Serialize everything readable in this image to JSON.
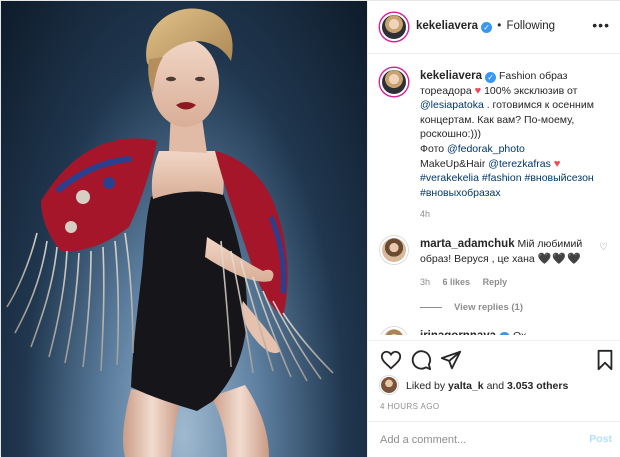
{
  "header": {
    "username": "kekeliavera",
    "dot": "•",
    "follow_label": "Following",
    "more": "•••"
  },
  "caption": {
    "username": "kekeliavera",
    "t1": "Fashion образ тореадора",
    "t2": "100% эксклюзив от",
    "mention1": "@lesiapatoka",
    "t3": ". готовимся к осенним концертам. Как вам? По-моему, роскошно:)))",
    "t4": "Фото",
    "mention2": "@fedorak_photo",
    "t5": "MakeUp&Hair",
    "mention3": "@terezkafras",
    "tags": "#verakekelia #fashion #вновыйсезон #вновыхобразах",
    "time": "4h"
  },
  "comments": [
    {
      "username": "marta_adamchuk",
      "text": "Мій любимий образ! Веруся , це хана",
      "emoji": "🖤🖤🖤",
      "time": "3h",
      "likes": "6 likes",
      "reply": "Reply",
      "view_replies": "View replies (1)"
    },
    {
      "username": "irinagornnaya",
      "text": "Ох"
    }
  ],
  "likes": {
    "prefix": "Liked by",
    "user": "yalta_k",
    "and": "and",
    "others": "3.053 others"
  },
  "timestamp": "4 HOURS AGO",
  "add_comment": {
    "placeholder": "Add a comment...",
    "post_label": "Post"
  },
  "icons": {
    "like": "heart-outline-icon",
    "comment": "speech-bubble-icon",
    "share": "paper-plane-icon",
    "save": "bookmark-icon"
  },
  "colors": {
    "link": "#00376b",
    "verified": "#3897f0",
    "heart": "#ed4956",
    "post_disabled": "#b2dffc"
  }
}
